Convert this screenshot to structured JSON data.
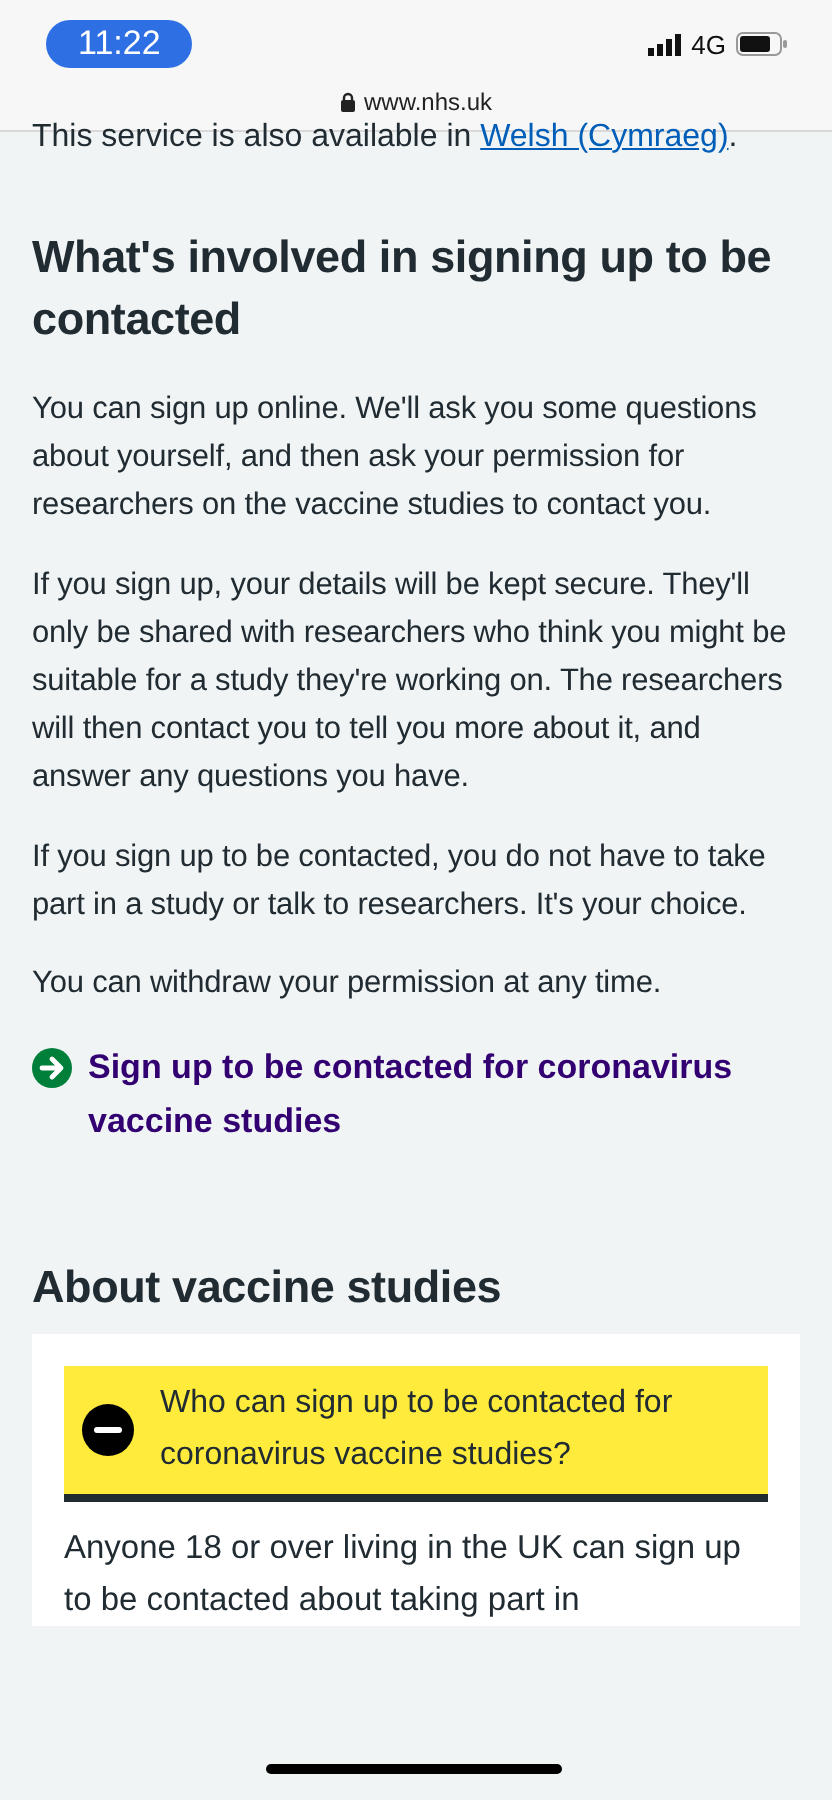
{
  "status_bar": {
    "time": "11:22",
    "network": "4G"
  },
  "browser": {
    "url": "www.nhs.uk"
  },
  "intro": {
    "text": "This service is also available in ",
    "link": "Welsh (Cymraeg)",
    "after": "."
  },
  "section_1": {
    "heading": "What's involved in signing up to be contacted",
    "paragraphs": [
      "You can sign up online. We'll ask you some questions about yourself, and then ask your permission for researchers on the vaccine studies to contact you.",
      "If you sign up, your details will be kept secure. They'll only be shared with researchers who think you might be suitable for a study they're working on. The researchers will then contact you to tell you more about it, and answer any questions you have.",
      "If you sign up to be contacted, you do not have to take part in a study or talk to researchers. It's your choice.",
      "You can withdraw your permission at any time."
    ],
    "action_link": "Sign up to be contacted for coronavirus vaccine studies"
  },
  "section_2": {
    "heading": "About vaccine studies",
    "accordion": [
      {
        "title": "Who can sign up to be contacted for coronavirus vaccine studies?",
        "expanded": true,
        "body": "Anyone 18 or over living in the UK can sign up to be contacted about taking part in"
      }
    ]
  }
}
